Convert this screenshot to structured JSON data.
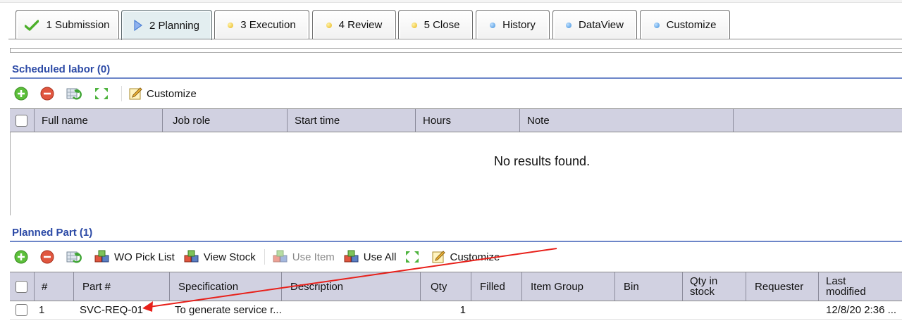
{
  "tabs": [
    {
      "label": "1 Submission",
      "icon": "checkmark-icon",
      "status_color": "#4caf2a"
    },
    {
      "label": "2 Planning",
      "icon": "play-triangle-icon",
      "status_color": "#4a7fd4",
      "active": true
    },
    {
      "label": "3 Execution",
      "icon": "yellow-dot-icon",
      "status_color": "#e8b61a"
    },
    {
      "label": "4 Review",
      "icon": "yellow-dot-icon",
      "status_color": "#e8b61a"
    },
    {
      "label": "5 Close",
      "icon": "yellow-dot-icon",
      "status_color": "#e8b61a"
    },
    {
      "label": "History",
      "icon": "blue-dot-icon",
      "status_color": "#3f8fdc"
    },
    {
      "label": "DataView",
      "icon": "blue-dot-icon",
      "status_color": "#3f8fdc"
    },
    {
      "label": "Customize",
      "icon": "blue-dot-icon",
      "status_color": "#3f8fdc"
    }
  ],
  "scheduled_labor": {
    "title": "Scheduled labor (0)",
    "toolbar": {
      "customize_label": "Customize"
    },
    "columns": [
      "Full name",
      "Job role",
      "Start time",
      "Hours",
      "Note"
    ],
    "empty_message": "No results found."
  },
  "planned_part": {
    "title": "Planned Part (1)",
    "toolbar": {
      "pick_list_label": "WO Pick List",
      "view_stock_label": "View Stock",
      "use_item_label": "Use Item",
      "use_all_label": "Use All",
      "customize_label": "Customize"
    },
    "columns": {
      "num": "#",
      "part": "Part #",
      "spec": "Specification",
      "desc": "Description",
      "qty": "Qty",
      "filled": "Filled",
      "group": "Item Group",
      "bin": "Bin",
      "stock_line1": "Qty in",
      "stock_line2": "stock",
      "requester": "Requester",
      "modified_line1": "Last",
      "modified_line2": "modified"
    },
    "rows": [
      {
        "num": "1",
        "part": "SVC-REQ-01",
        "spec": "To generate service r...",
        "qty": "1",
        "modified": "12/8/20 2:36 ..."
      }
    ]
  },
  "colors": {
    "section_title": "#2c4aa6",
    "grid_header_bg": "#d1d1e1",
    "annotation_arrow": "#e8201a"
  }
}
